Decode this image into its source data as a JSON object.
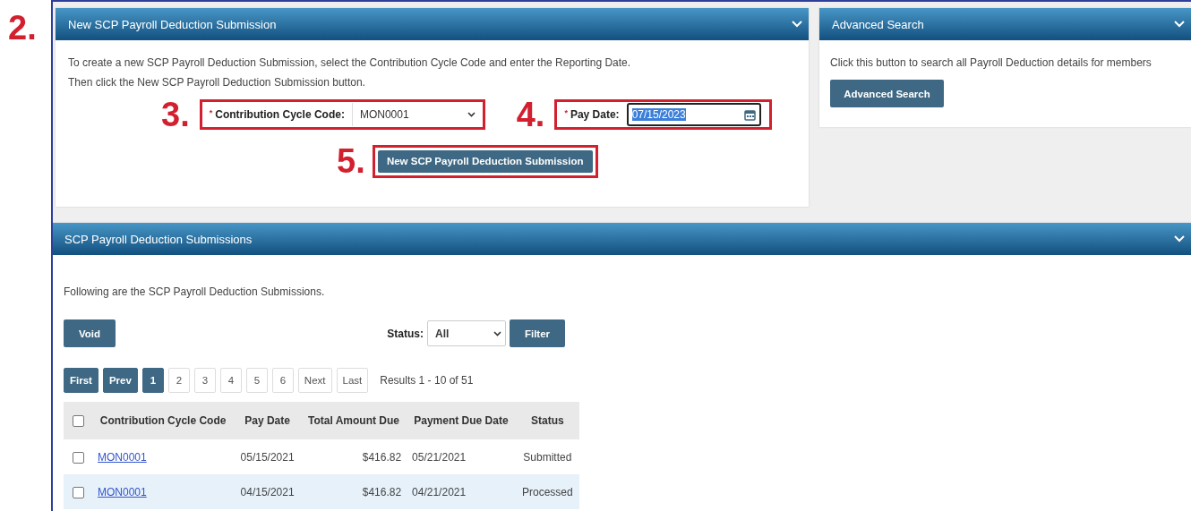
{
  "new_submission": {
    "callout": "2.",
    "title": "New SCP Payroll Deduction Submission",
    "instructions": [
      "To create a new SCP Payroll Deduction Submission, select the Contribution Cycle Code and enter the Reporting Date.",
      "Then click the New SCP Payroll Deduction Submission button."
    ],
    "cycle_code": {
      "callout": "3.",
      "required_mark": "*",
      "label": "Contribution Cycle Code:",
      "value": "MON0001"
    },
    "pay_date": {
      "callout": "4.",
      "required_mark": "*",
      "label": "Pay Date:",
      "value": "07/15/2023",
      "text_selected": true
    },
    "submit": {
      "callout": "5.",
      "label": "New SCP Payroll Deduction Submission"
    }
  },
  "advanced_search": {
    "title": "Advanced Search",
    "description": "Click this button to search all Payroll Deduction details for members",
    "button": "Advanced Search"
  },
  "submissions": {
    "title": "SCP Payroll Deduction Submissions",
    "intro": "Following are the SCP Payroll Deduction Submissions.",
    "void_button": "Void",
    "status_filter": {
      "label": "Status:",
      "value": "All"
    },
    "filter_button": "Filter",
    "pagination": {
      "first": "First",
      "prev": "Prev",
      "pages": [
        {
          "label": "1",
          "selected": true
        },
        {
          "label": "2",
          "selected": false
        },
        {
          "label": "3",
          "selected": false
        },
        {
          "label": "4",
          "selected": false
        },
        {
          "label": "5",
          "selected": false
        },
        {
          "label": "6",
          "selected": false
        }
      ],
      "next": "Next",
      "last": "Last",
      "results": "Results 1 - 10 of 51"
    },
    "table": {
      "select_all_checked": false,
      "columns": [
        "Contribution Cycle Code",
        "Pay Date",
        "Total Amount Due",
        "Payment Due Date",
        "Status"
      ],
      "rows": [
        {
          "checked": false,
          "cells": [
            "MON0001",
            "05/15/2021",
            "$416.82",
            "05/21/2021",
            "Submitted"
          ]
        },
        {
          "checked": false,
          "cells": [
            "MON0001",
            "04/15/2021",
            "$416.82",
            "04/21/2021",
            "Processed"
          ]
        }
      ]
    }
  }
}
